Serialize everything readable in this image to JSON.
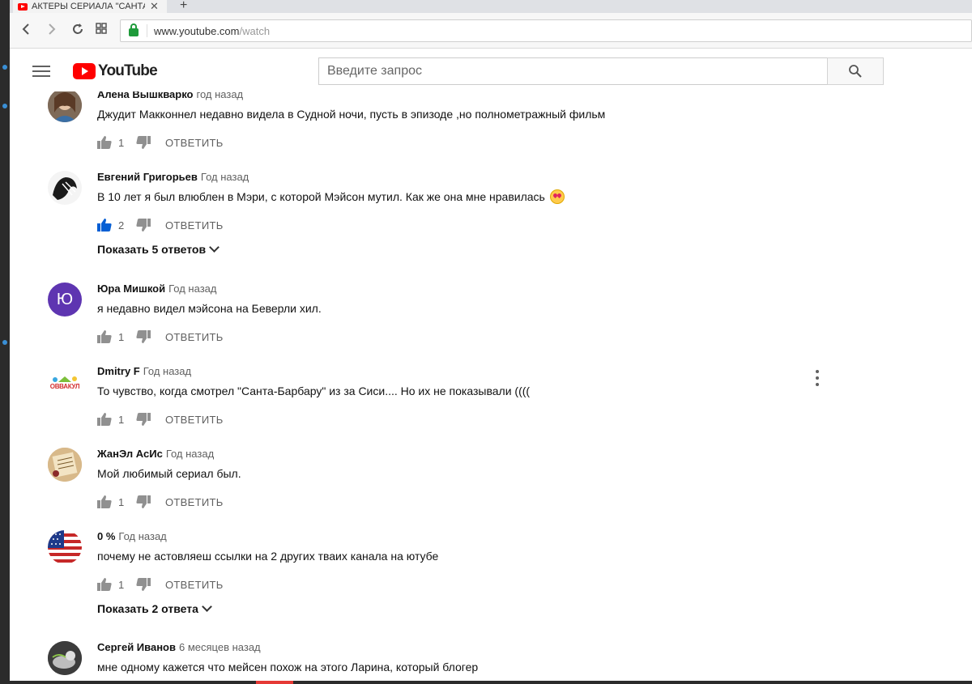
{
  "browser": {
    "tab_title": "АКТЕРЫ СЕРИАЛА \"САНТА",
    "tab_close": "✕",
    "new_tab": "+",
    "url_host": "www.youtube.com",
    "url_path": "/watch"
  },
  "header": {
    "logo_text": "YouTube",
    "search_placeholder": "Введите запрос"
  },
  "colors": {
    "brand_red": "#ff0000",
    "liked_blue": "#065fd4",
    "icon_gray": "#909090"
  },
  "comments": [
    {
      "author": "Алена Вышкварко",
      "time": "год назад",
      "text": "Джудит Макконнел недавно видела в Судной ночи, пусть в эпизоде ,но полнометражный фильм",
      "likes": "1",
      "reply": "ОТВЕТИТЬ",
      "liked": false
    },
    {
      "author": "Евгений Григорьев",
      "time": "Год назад",
      "text": "В 10 лет я был влюблен в Мэри, с которой Мэйсон мутил. Как же она мне нравилась",
      "likes": "2",
      "reply": "ОТВЕТИТЬ",
      "liked": true,
      "show_replies": "Показать 5 ответов"
    },
    {
      "author": "Юра Мишкой",
      "time": "Год назад",
      "text": "я недавно видел мэйсона на Беверли хил.",
      "likes": "1",
      "reply": "ОТВЕТИТЬ",
      "liked": false,
      "avatar_letter": "Ю"
    },
    {
      "author": "Dmitry F",
      "time": "Год назад",
      "text": "То чувство, когда смотрел \"Санта-Барбару\" из за Сиси.... Но их не показывали ((((",
      "likes": "1",
      "reply": "ОТВЕТИТЬ",
      "liked": false,
      "avatar_text": "ОВВАКУЛ"
    },
    {
      "author": "ЖанЭл АсИс",
      "time": "Год назад",
      "text": "Мой любимый сериал был.",
      "likes": "1",
      "reply": "ОТВЕТИТЬ",
      "liked": false
    },
    {
      "author": "0 %",
      "time": "Год назад",
      "text": "почему не астовляеш ссылки на 2 других тваих канала на ютубе",
      "likes": "1",
      "reply": "ОТВЕТИТЬ",
      "liked": false,
      "show_replies": "Показать 2 ответа"
    },
    {
      "author": "Сергей Иванов",
      "time": "6 месяцев назад",
      "text": "мне одному кажется что мейсен похож на этого Ларина, который блогер"
    }
  ]
}
